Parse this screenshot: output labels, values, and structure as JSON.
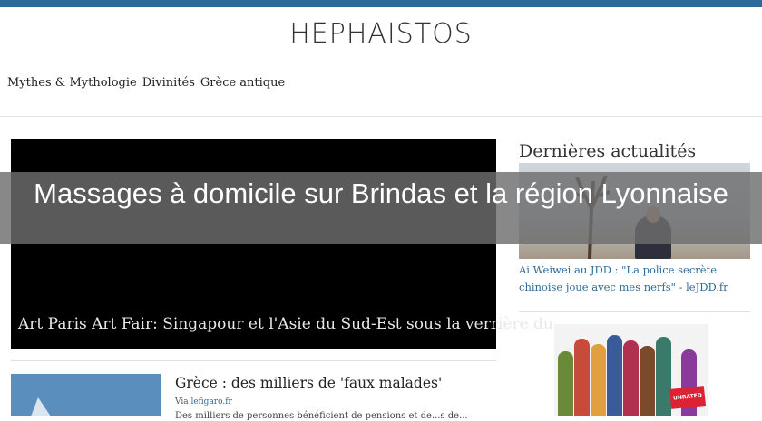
{
  "header": {
    "site_title": "HEPHAISTOS",
    "tags": [
      "Mythes & Mythologie",
      "Divinités",
      "Grèce antique"
    ]
  },
  "hero": {
    "caption": "Art Paris Art Fair: Singapour et l'Asie du Sud-Est sous la verrière du"
  },
  "sidebar": {
    "title": "Dernières actualités",
    "item1_link": "Ai Weiwei au JDD : \"La police secrète chinoise joue avec mes nerfs\" - leJDD.fr",
    "item2_image_label": "UNRATED"
  },
  "article": {
    "title": "Grèce : des milliers de 'faux malades'",
    "via_label": "Via",
    "via_source": "lefigaro.fr",
    "excerpt": "Des milliers de personnes bénéficient de pensions et de...s de..."
  },
  "overlay": {
    "text": "Massages à domicile sur Brindas et la région Lyonnaise"
  },
  "colors": {
    "accent": "#2c6a99",
    "hero_bg": "#000000",
    "overlay_bg": "#6e6e6e"
  }
}
